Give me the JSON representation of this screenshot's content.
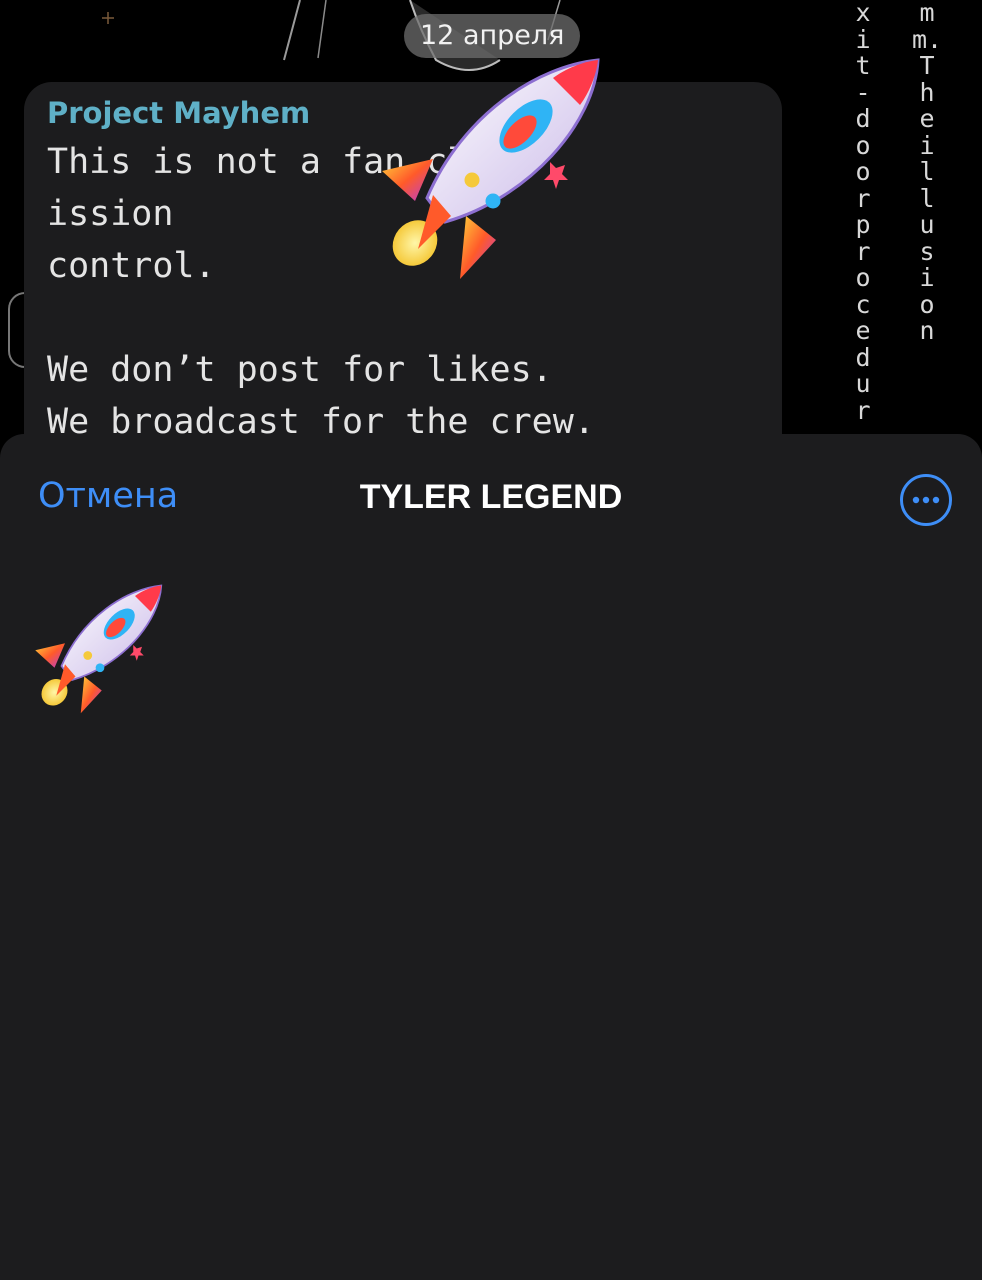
{
  "chat": {
    "date_label": "12 апреля",
    "message": {
      "sender": "Project Mayhem",
      "text": "This is not a fan club⁠              ission\ncontrol.\n\nWe don’t post for likes.\nWe broadcast for the crew.\nEvery share, every forward — fuel for the"
    },
    "background_text": {
      "column_1": "xit-door procedur",
      "column_2": "mm. The illusion"
    },
    "animated_sticker": "rocket-sticker"
  },
  "sheet": {
    "cancel_label": "Отмена",
    "title": "TYLER LEGEND",
    "more_icon": "ellipsis-circle-icon",
    "stickers": [
      {
        "icon": "rocket-sticker"
      }
    ]
  },
  "colors": {
    "accent": "#3e8ef7",
    "sender": "#5fb0c7",
    "sheet_bg": "#1c1c1e",
    "bubble_bg": "#1c1c1e",
    "screen_bg": "#000000"
  }
}
